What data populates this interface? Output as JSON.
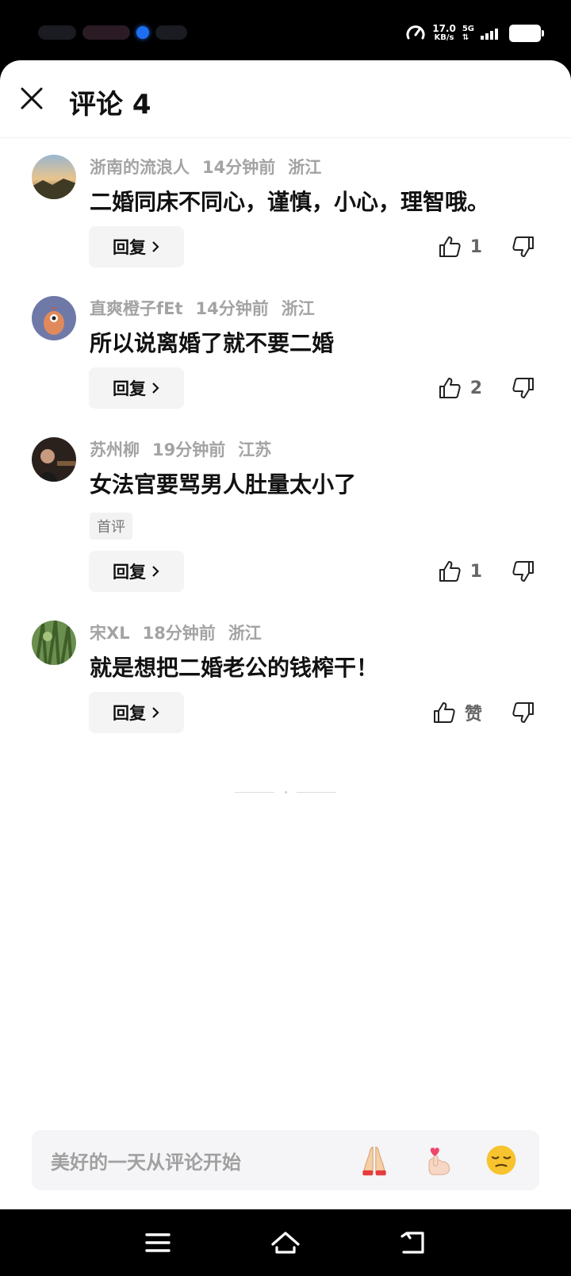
{
  "status_bar": {
    "net_speed": "17.0",
    "net_unit": "KB/s",
    "net_type": "5G"
  },
  "header": {
    "title": "评论 4"
  },
  "comments": [
    {
      "username": "浙南的流浪人",
      "time": "14分钟前",
      "location": "浙江",
      "text": "二婚同床不同心，谨慎，小心，理智哦。",
      "reply_label": "回复",
      "likes": "1",
      "avatar": "sunset-landscape"
    },
    {
      "username": "直爽橙子fEt",
      "time": "14分钟前",
      "location": "浙江",
      "text": "所以说离婚了就不要二婚",
      "reply_label": "回复",
      "likes": "2",
      "avatar": "cartoon-chick"
    },
    {
      "username": "苏州柳",
      "time": "19分钟前",
      "location": "江苏",
      "text": "女法官要骂男人肚量太小了",
      "tag": "首评",
      "reply_label": "回复",
      "likes": "1",
      "avatar": "portrait-dark"
    },
    {
      "username": "宋XL",
      "time": "18分钟前",
      "location": "浙江",
      "text": "就是想把二婚老公的钱榨干！",
      "reply_label": "回复",
      "likes": "赞",
      "avatar": "green-plants"
    }
  ],
  "input": {
    "placeholder": "美好的一天从评论开始",
    "emojis": [
      "praying-hands-emoji",
      "finger-heart-emoji",
      "smirk-face-emoji"
    ]
  },
  "colors": {
    "meta_text": "#a3a3a3",
    "primary_text": "#111111",
    "reply_bg": "#f4f4f4"
  }
}
